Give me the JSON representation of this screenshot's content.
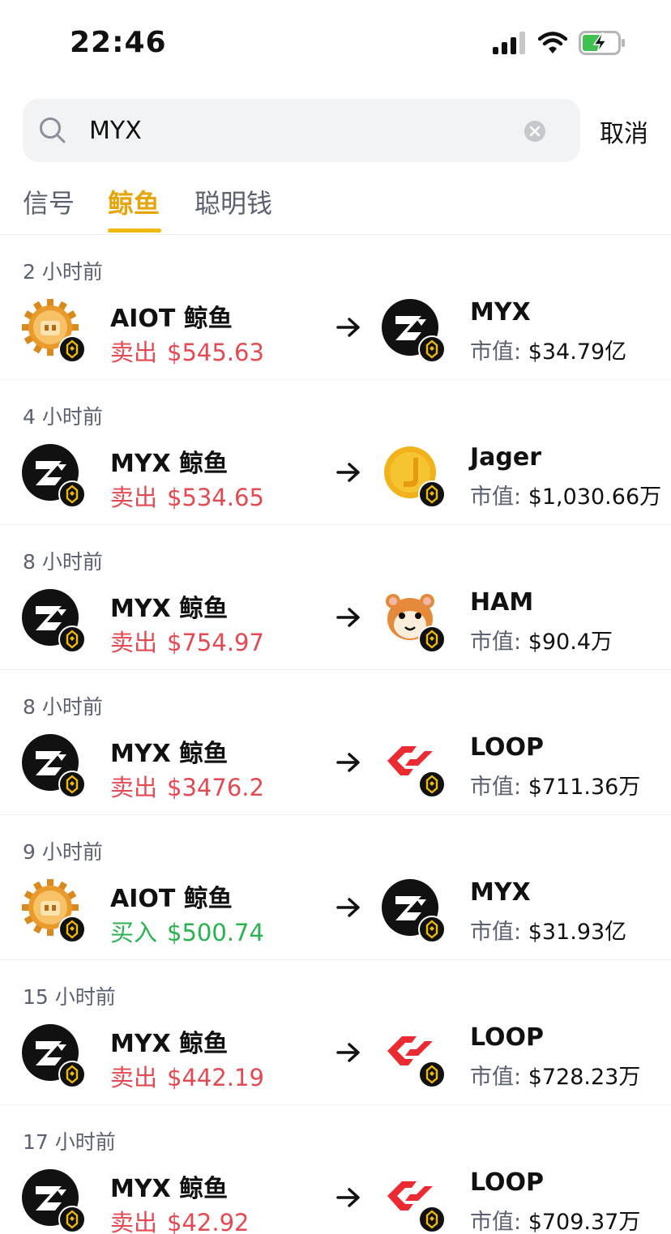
{
  "status_bar": {
    "time": "22:46"
  },
  "search": {
    "query": "MYX",
    "cancel_label": "取消"
  },
  "tabs": [
    {
      "label": "信号",
      "active": false
    },
    {
      "label": "鲸鱼",
      "active": true
    },
    {
      "label": "聪明钱",
      "active": false
    }
  ],
  "colors": {
    "accent": "#f0b90b",
    "sell": "#e44a52",
    "buy": "#28b34f",
    "secondary_text": "#5b6170"
  },
  "mcap_label": "市值:",
  "items": [
    {
      "time": "2 小时前",
      "whale": "AIOT 鲸鱼",
      "whale_icon": "aiot-coin",
      "action": "卖出",
      "amount": "$545.63",
      "side": "sell",
      "token": "MYX",
      "token_icon": "myx-logo",
      "mcap": "$34.79亿"
    },
    {
      "time": "4 小时前",
      "whale": "MYX 鲸鱼",
      "whale_icon": "myx-logo",
      "action": "卖出",
      "amount": "$534.65",
      "side": "sell",
      "token": "Jager",
      "token_icon": "jager-coin",
      "mcap": "$1,030.66万"
    },
    {
      "time": "8 小时前",
      "whale": "MYX 鲸鱼",
      "whale_icon": "myx-logo",
      "action": "卖出",
      "amount": "$754.97",
      "side": "sell",
      "token": "HAM",
      "token_icon": "ham-hamster",
      "mcap": "$90.4万"
    },
    {
      "time": "8 小时前",
      "whale": "MYX 鲸鱼",
      "whale_icon": "myx-logo",
      "action": "卖出",
      "amount": "$3476.2",
      "side": "sell",
      "token": "LOOP",
      "token_icon": "loop-logo",
      "mcap": "$711.36万"
    },
    {
      "time": "9 小时前",
      "whale": "AIOT 鲸鱼",
      "whale_icon": "aiot-coin",
      "action": "买入",
      "amount": "$500.74",
      "side": "buy",
      "token": "MYX",
      "token_icon": "myx-logo",
      "mcap": "$31.93亿"
    },
    {
      "time": "15 小时前",
      "whale": "MYX 鲸鱼",
      "whale_icon": "myx-logo",
      "action": "卖出",
      "amount": "$442.19",
      "side": "sell",
      "token": "LOOP",
      "token_icon": "loop-logo",
      "mcap": "$728.23万"
    },
    {
      "time": "17 小时前",
      "whale": "MYX 鲸鱼",
      "whale_icon": "myx-logo",
      "action": "卖出",
      "amount": "$42.92",
      "side": "sell",
      "token": "LOOP",
      "token_icon": "loop-logo",
      "mcap": "$709.37万"
    }
  ]
}
